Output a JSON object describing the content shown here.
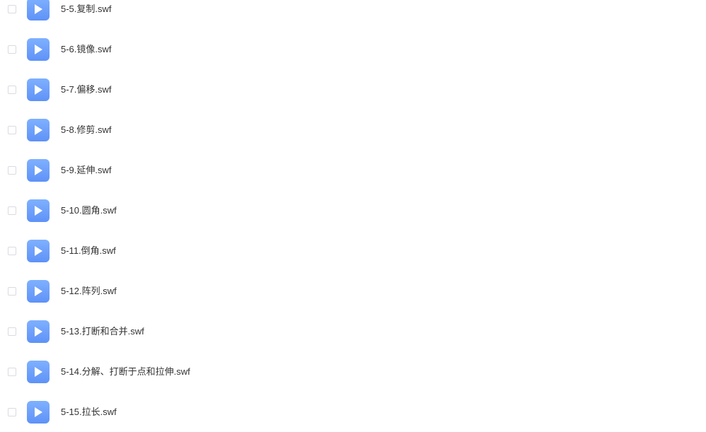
{
  "files": [
    {
      "name": "5-5.复制.swf",
      "icon": "video-play-icon"
    },
    {
      "name": "5-6.镜像.swf",
      "icon": "video-play-icon"
    },
    {
      "name": "5-7.偏移.swf",
      "icon": "video-play-icon"
    },
    {
      "name": "5-8.修剪.swf",
      "icon": "video-play-icon"
    },
    {
      "name": "5-9.延伸.swf",
      "icon": "video-play-icon"
    },
    {
      "name": "5-10.圆角.swf",
      "icon": "video-play-icon"
    },
    {
      "name": "5-11.倒角.swf",
      "icon": "video-play-icon"
    },
    {
      "name": "5-12.阵列.swf",
      "icon": "video-play-icon"
    },
    {
      "name": "5-13.打断和合并.swf",
      "icon": "video-play-icon"
    },
    {
      "name": "5-14.分解、打断于点和拉伸.swf",
      "icon": "video-play-icon"
    },
    {
      "name": "5-15.拉长.swf",
      "icon": "video-play-icon"
    }
  ],
  "colors": {
    "icon_top": "#7fb0ff",
    "icon_bottom": "#5e92f7",
    "text": "#333333",
    "checkbox_border": "#d9dbe1"
  }
}
